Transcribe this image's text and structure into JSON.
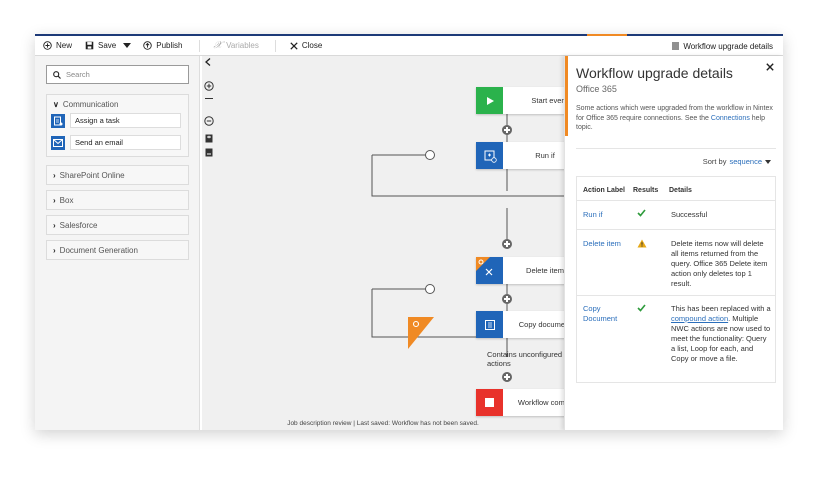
{
  "toolbar": {
    "new_label": "New",
    "save_label": "Save",
    "publish_label": "Publish",
    "variables_label": "Variables",
    "close_label": "Close",
    "upgrade_label": "Workflow upgrade details"
  },
  "sidebar": {
    "search_placeholder": "Search",
    "categories": [
      {
        "label": "Communication",
        "expanded": true,
        "items": [
          {
            "label": "Assign a task",
            "icon": "assign-task-icon"
          },
          {
            "label": "Send an email",
            "icon": "email-icon"
          }
        ]
      },
      {
        "label": "SharePoint Online",
        "expanded": false
      },
      {
        "label": "Box",
        "expanded": false
      },
      {
        "label": "Salesforce",
        "expanded": false
      },
      {
        "label": "Document Generation",
        "expanded": false
      }
    ]
  },
  "canvas": {
    "nodes": [
      {
        "label": "Start event",
        "color": "#2bb24c"
      },
      {
        "label": "Run if",
        "color": "#2065b8"
      },
      {
        "label": "Delete item",
        "color": "#2065b8"
      },
      {
        "label": "Copy document",
        "color": "#2065b8"
      },
      {
        "label": "Workflow complete",
        "color": "#e8322b"
      }
    ],
    "unconfigured_text": "Contains unconfigured actions",
    "more_label": "•••",
    "status": "Job description review  |  Last saved: Workflow has not been saved."
  },
  "panel": {
    "title": "Workflow upgrade details",
    "subtitle": "Office 365",
    "description_pre": "Some actions which were upgraded from the workflow in Nintex for Office 365 require connections.  See the ",
    "description_link": "Connections",
    "description_post": " help topic.",
    "sort_label": "Sort by",
    "sort_value": "sequence",
    "columns": [
      "Action Label",
      "Results",
      "Details"
    ],
    "rows": [
      {
        "action": "Run if",
        "result": "success",
        "details": "Successful"
      },
      {
        "action": "Delete item",
        "result": "warning",
        "details": "Delete items now will delete all items returned from the query. Office 365 Delete item action only deletes top 1 result."
      },
      {
        "action": "Copy Document",
        "result": "success",
        "details_pre": "This has been replaced with a ",
        "details_link": "compound action",
        "details_post": ". Multiple NWC actions are now used to meet the functionality: Query a list, Loop for each, and Copy or move a file."
      }
    ]
  },
  "colors": {
    "accent": "#f08a24",
    "brand": "#1d3a78",
    "link": "#2a6ebb",
    "success": "#2e9b3c",
    "warning": "#e6a817"
  }
}
